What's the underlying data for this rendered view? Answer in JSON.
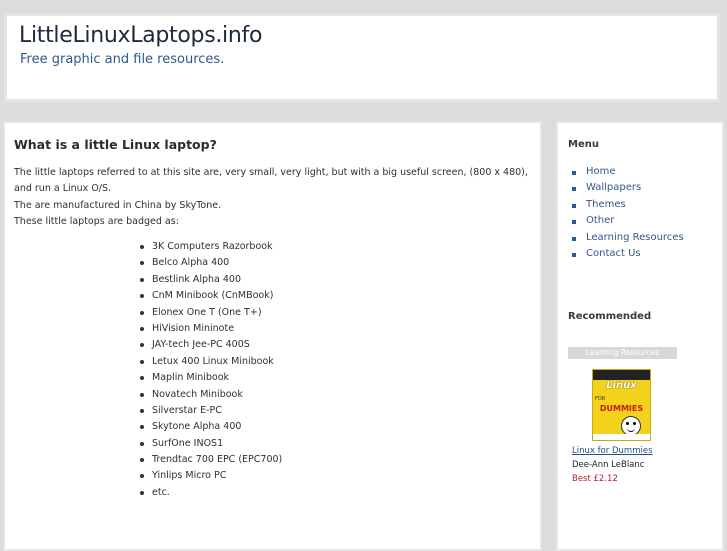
{
  "header": {
    "title": "LittleLinuxLaptops.info",
    "subtitle": "Free graphic and file resources."
  },
  "main": {
    "heading": "What is a little Linux laptop?",
    "paragraphs": [
      "The little laptops referred to at this site are, very small, very light, but with a big useful screen, (800 x 480), and run a Linux O/S.",
      "The are manufactured in China by SkyTone.",
      "These little laptops are badged as:"
    ],
    "laptops": [
      "3K Computers Razorbook",
      "Belco Alpha 400",
      "Bestlink Alpha 400",
      "CnM Minibook (CnMBook)",
      "Elonex One T (One T+)",
      "HiVision Mininote",
      "JAY-tech Jee-PC 400S",
      "Letux 400 Linux Minibook",
      "Maplin Minibook",
      "Novatech Minibook",
      "Silverstar E-PC",
      "Skytone Alpha 400",
      "SurfOne INOS1",
      "Trendtac 700 EPC (EPC700)",
      "Yinlips Micro PC",
      "etc."
    ]
  },
  "sidebar": {
    "menu_heading": "Menu",
    "menu": [
      "Home",
      "Wallpapers",
      "Themes",
      "Other",
      "Learning Resources",
      "Contact Us"
    ],
    "recommended_heading": "Recommended",
    "badge": "Learning Resources",
    "book": {
      "cover_title": "Linux",
      "cover_for": "FOR",
      "cover_series": "DUMMIES",
      "link": "Linux for Dummies",
      "author": "Dee-Ann LeBlanc",
      "price": "Best £2.12"
    }
  },
  "colors": {
    "link": "#2d5a8a",
    "price": "#b0242a",
    "background": "#dcdcdc"
  }
}
